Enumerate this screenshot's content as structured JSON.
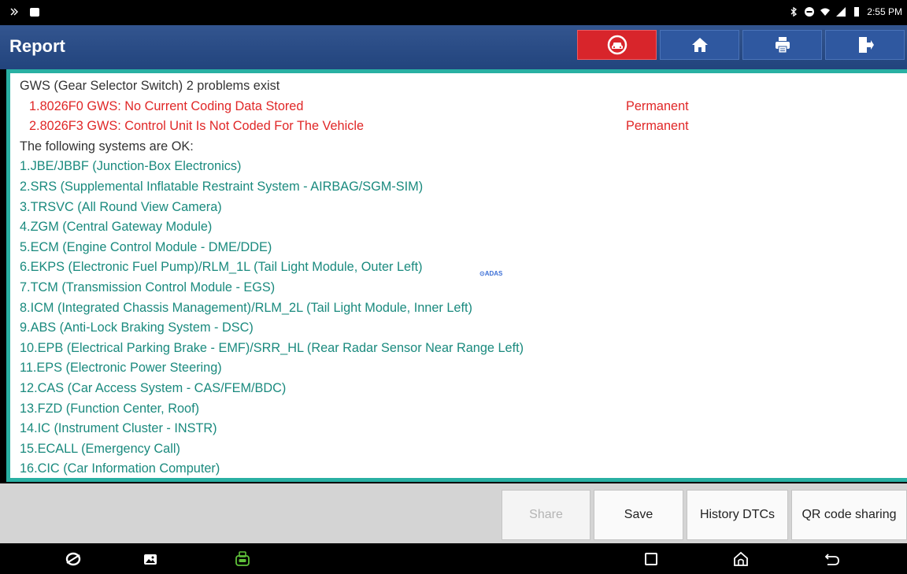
{
  "status_bar": {
    "time": "2:55 PM"
  },
  "header": {
    "title": "Report",
    "buttons": [
      {
        "icon": "car-diagnostic-icon",
        "color": "#d8252b"
      },
      {
        "icon": "home-icon"
      },
      {
        "icon": "print-icon"
      },
      {
        "icon": "exit-icon"
      }
    ]
  },
  "report": {
    "heading": "GWS (Gear Selector Switch) 2 problems exist",
    "faults": [
      {
        "text": "1.8026F0 GWS: No Current Coding Data Stored",
        "status": "Permanent"
      },
      {
        "text": "2.8026F3 GWS: Control Unit Is Not Coded For The Vehicle",
        "status": "Permanent"
      }
    ],
    "ok_heading": "The following systems are OK:",
    "ok_systems": [
      "1.JBE/JBBF (Junction-Box Electronics)",
      "2.SRS (Supplemental Inflatable Restraint System - AIRBAG/SGM-SIM)",
      "3.TRSVC (All Round View Camera)",
      "4.ZGM (Central Gateway Module)",
      "5.ECM (Engine Control Module - DME/DDE)",
      "6.EKPS (Electronic Fuel Pump)/RLM_1L (Tail Light Module, Outer Left)",
      "7.TCM (Transmission Control Module - EGS)",
      "8.ICM (Integrated Chassis Management)/RLM_2L (Tail Light Module, Inner Left)",
      "9.ABS (Anti-Lock Braking System - DSC)",
      "10.EPB (Electrical Parking Brake - EMF)/SRR_HL (Rear Radar Sensor Near Range Left)",
      "11.EPS (Electronic Power Steering)",
      "12.CAS (Car Access System - CAS/FEM/BDC)",
      "13.FZD (Function Center, Roof)",
      "14.IC (Instrument Cluster - INSTR)",
      "15.ECALL (Emergency Call)",
      "16.CIC (Car Information Computer)"
    ],
    "adas_badge": "⊙ADAS",
    "fault_color": "#e02727",
    "ok_color": "#1a8a7e"
  },
  "actions": {
    "share": "Share",
    "save": "Save",
    "history": "History DTCs",
    "qr": "QR code sharing"
  },
  "colors": {
    "header_bg": "#22447d",
    "frame_border": "#29b0a3"
  }
}
